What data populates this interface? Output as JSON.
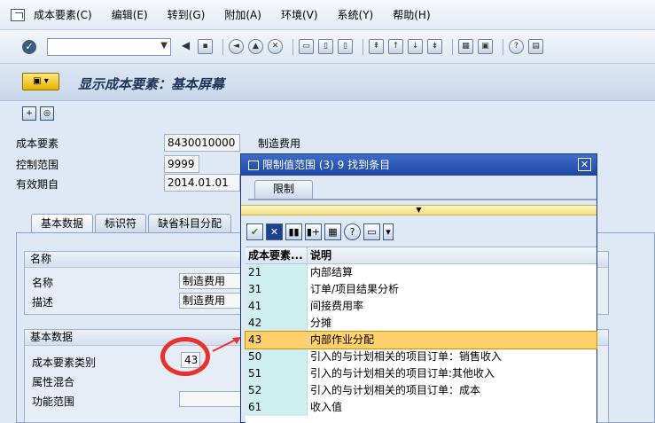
{
  "menu": {
    "items": [
      "成本要素(C)",
      "编辑(E)",
      "转到(G)",
      "附加(A)",
      "环境(V)",
      "系统(Y)",
      "帮助(H)"
    ]
  },
  "header": {
    "title": "显示成本要素：基本屏幕"
  },
  "fields": {
    "cost_element_label": "成本要素",
    "cost_element_value": "8430010000",
    "cost_element_desc": "制造费用",
    "controlling_area_label": "控制范围",
    "controlling_area_value": "9999",
    "valid_from_label": "有效期自",
    "valid_from_value": "2014.01.01"
  },
  "tabs": [
    "基本数据",
    "标识符",
    "缺省科目分配"
  ],
  "name_group": {
    "title": "名称",
    "name_label": "名称",
    "name_value": "制造费用",
    "desc_label": "描述",
    "desc_value": "制造费用"
  },
  "basic_group": {
    "title": "基本数据",
    "category_label": "成本要素类别",
    "category_value": "43",
    "attr_label": "属性混合",
    "func_label": "功能范围"
  },
  "dialog": {
    "title": "限制值范围 (3)   9 找到条目",
    "tab": "限制",
    "col_code": "成本要素...",
    "col_desc": "说明",
    "rows": [
      {
        "code": "21",
        "desc": "内部结算"
      },
      {
        "code": "31",
        "desc": "订单/项目结果分析"
      },
      {
        "code": "41",
        "desc": "间接费用率"
      },
      {
        "code": "42",
        "desc": "分摊"
      },
      {
        "code": "43",
        "desc": "内部作业分配"
      },
      {
        "code": "50",
        "desc": "引入的与计划相关的项目订单：销售收入"
      },
      {
        "code": "51",
        "desc": "引入的与计划相关的项目订单:其他收入"
      },
      {
        "code": "52",
        "desc": "引入的与计划相关的项目订单：成本"
      },
      {
        "code": "61",
        "desc": "收入值"
      }
    ],
    "selected_code": "43"
  },
  "colors": {
    "selection": "#ffd06b",
    "dialog_title": "#1d47a2",
    "highlight_circle": "#e8322e"
  }
}
